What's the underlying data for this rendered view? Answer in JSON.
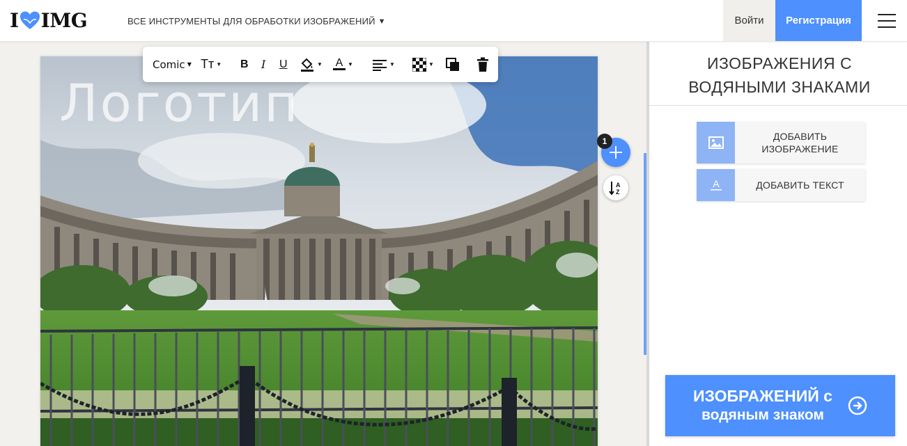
{
  "header": {
    "logo_left": "I",
    "logo_right": "IMG",
    "tools_menu_label": "ВСЕ ИНСТРУМЕНТЫ ДЛЯ ОБРАБОТКИ ИЗОБРАЖЕНИЙ",
    "login_label": "Войти",
    "signup_label": "Регистрация"
  },
  "toolbar": {
    "font_label": "Comic",
    "size_label": "Тт",
    "bold_label": "B",
    "italic_label": "I",
    "underline_label": "U",
    "color_label": "A"
  },
  "canvas": {
    "watermark_text": "Логотип",
    "layer_count": "1",
    "sort_icon_label": "AZ"
  },
  "sidebar": {
    "title_line1": "ИЗОБРАЖЕНИЯ С",
    "title_line2": "ВОДЯНЫМИ ЗНАКАМИ",
    "add_image_line1": "ДОБАВИТЬ",
    "add_image_line2": "ИЗОБРАЖЕНИЕ",
    "add_text_label": "ДОБАВИТЬ ТЕКСТ",
    "process_line1": "ИЗОБРАЖЕНИЙ с",
    "process_line2": "водяным знаком"
  },
  "colors": {
    "accent": "#4d90fe",
    "accent_light": "#8fb4f5",
    "logo_heart": "#4d90fe"
  },
  "icons": {
    "logo": "heart-icon",
    "fill": "paint-bucket-icon",
    "align": "align-left-icon",
    "opacity": "checkerboard-icon",
    "layer": "layers-icon",
    "delete": "trash-icon",
    "add": "plus-icon",
    "sort": "sort-az-icon",
    "add_image": "image-icon",
    "add_text": "text-icon",
    "process": "arrow-right-circle-icon"
  }
}
